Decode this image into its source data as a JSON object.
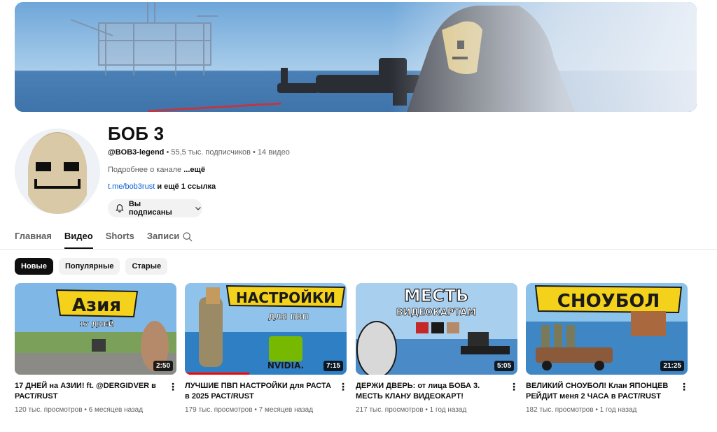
{
  "channel": {
    "name": "БОБ 3",
    "handle": "@BOB3-legend",
    "subscribers": "55,5 тыс. подписчиков",
    "videos_count": "14 видео",
    "about_text": "Подробнее о канале",
    "about_more": "...ещё",
    "link": "t.me/bob3rust",
    "more_links": "и ещё 1 ссылка",
    "subscribed_label": "Вы подписаны"
  },
  "tabs": [
    {
      "label": "Главная"
    },
    {
      "label": "Видео"
    },
    {
      "label": "Shorts"
    },
    {
      "label": "Записи"
    }
  ],
  "filters": [
    {
      "label": "Новые"
    },
    {
      "label": "Популярные"
    },
    {
      "label": "Старые"
    }
  ],
  "videos": [
    {
      "title": "17 ДНЕЙ на АЗИИ! ft. @DERGIDVER в РАСТ/RUST",
      "views": "120 тыс. просмотров",
      "age": "6 месяцев назад",
      "duration": "2:50",
      "thumb_text": "Азия",
      "thumb_sub": "17 ДНЕЙ"
    },
    {
      "title": "ЛУЧШИЕ ПВП НАСТРОЙКИ для РАСТА в 2025 РАСТ/RUST",
      "views": "179 тыс. просмотров",
      "age": "7 месяцев назад",
      "duration": "7:15",
      "thumb_text": "НАСТРОЙКИ",
      "thumb_sub": "ДЛЯ ПВП",
      "thumb_brand": "NVIDIA."
    },
    {
      "title": "ДЕРЖИ ДВЕРЬ: от лица БОБА 3. МЕСТЬ КЛАНУ ВИДЕОКАРТ!",
      "views": "217 тыс. просмотров",
      "age": "1 год назад",
      "duration": "5:05",
      "thumb_text": "МЕСТЬ",
      "thumb_sub": "ВИДЕОКАРТАМ"
    },
    {
      "title": "ВЕЛИКИЙ СНОУБОЛ! Клан ЯПОНЦЕВ РЕЙДИТ меня 2 ЧАСА в РАСТ/RUST",
      "views": "182 тыс. просмотров",
      "age": "1 год назад",
      "duration": "21:25",
      "thumb_text": "СНОУБОЛ"
    }
  ],
  "meta_separator": "•"
}
